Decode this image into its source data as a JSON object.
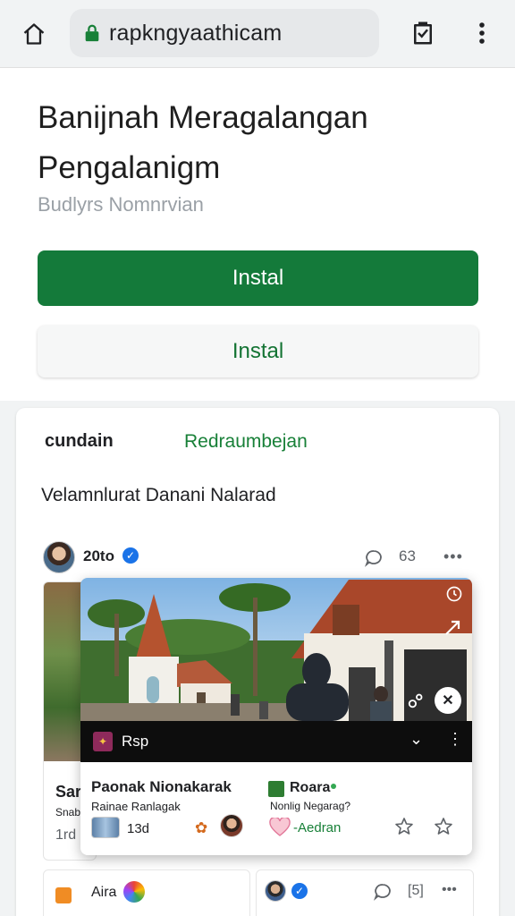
{
  "browser": {
    "url": "rapkngyaathicam",
    "icons": {
      "home": "home-icon",
      "lock": "lock-icon",
      "download": "download-icon",
      "menu": "more-vert-icon"
    }
  },
  "app": {
    "title_line1": "Banijnah Meragalangan",
    "title_line2": "Pengalanigm",
    "subtitle": "Budlyrs Nomnrvian",
    "install_primary": "Instal",
    "install_secondary": "Instal",
    "primary_color": "#147a3a"
  },
  "feed": {
    "tabs": [
      {
        "label": "cundain"
      },
      {
        "label": "Redraumbejan"
      }
    ],
    "section_title": "Velamnlurat Danani Nalarad",
    "post": {
      "author": "20to",
      "count": "63",
      "more": "•••"
    },
    "back_card": {
      "title": "Sar",
      "subtitle": "Snab",
      "meta": "1rd"
    },
    "overlay": {
      "bar_label": "Rsp",
      "item1_title": "Paonak Nionakarak",
      "item1_sub": "Rainae Ranlagak",
      "item2_title": "Roara",
      "item2_sub": "Nonlig Negarag?",
      "count": "13d",
      "action": "Aedran"
    },
    "bottom": {
      "name": "Aira",
      "count": "[5]",
      "more": "•••"
    }
  }
}
